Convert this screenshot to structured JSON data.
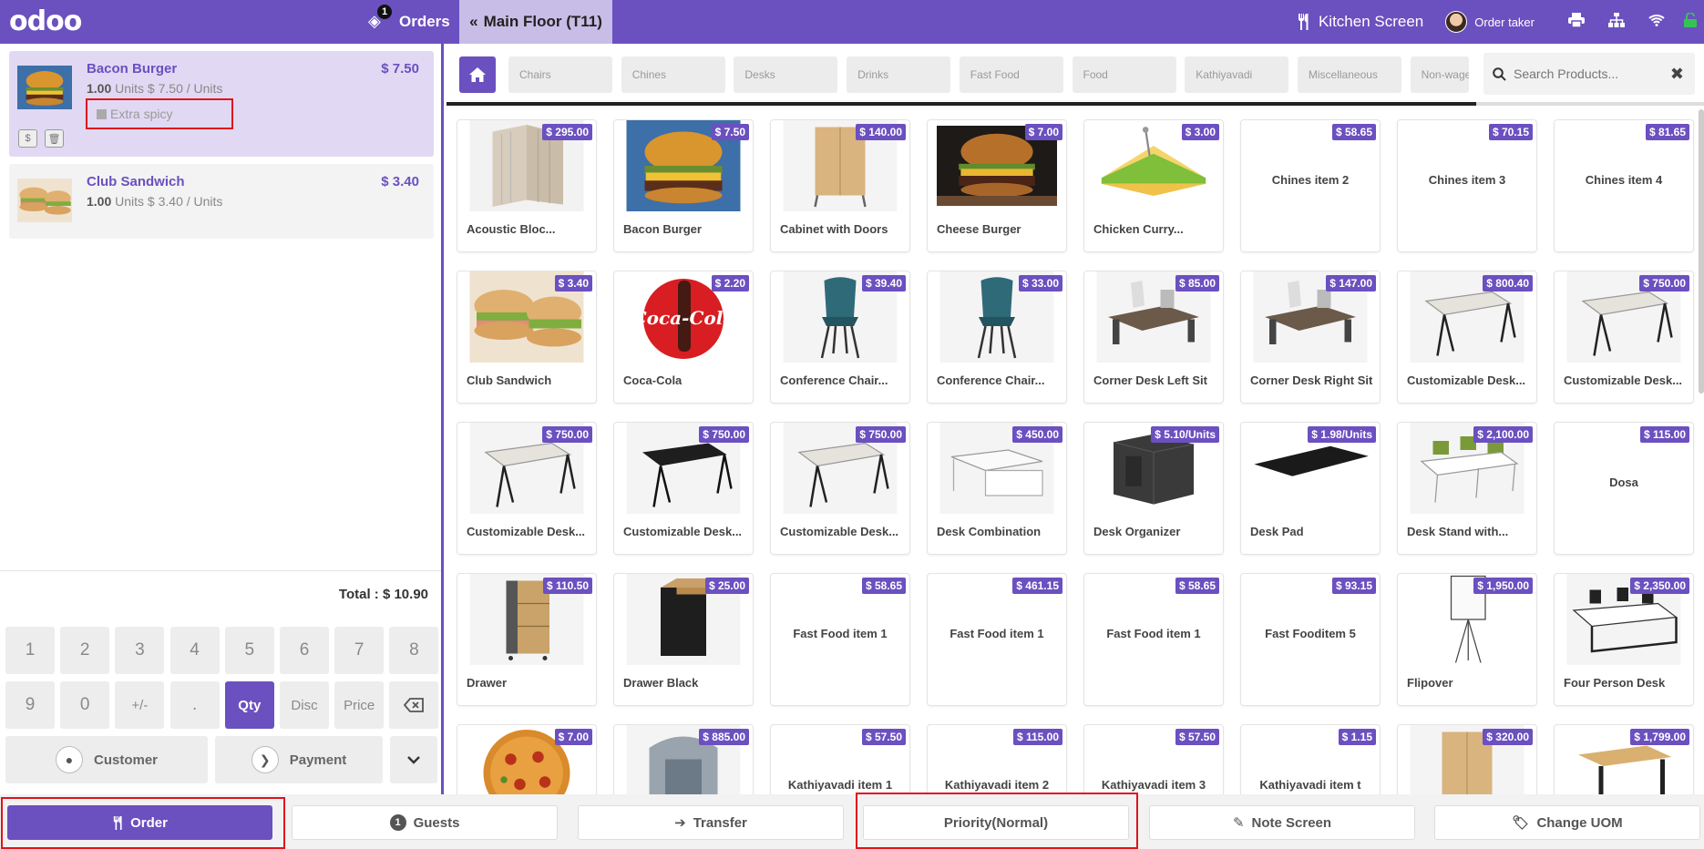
{
  "navbar": {
    "logo": "odoo",
    "orders_count": "1",
    "orders_label": "Orders",
    "floor_label": "Main Floor (T11)",
    "kitchen_label": "Kitchen Screen",
    "user_label": "Order taker"
  },
  "order_lines": [
    {
      "name": "Bacon Burger",
      "price": "$ 7.50",
      "qty": "1.00",
      "detail": "Units $ 7.50 / Units",
      "note": "Extra spicy",
      "img": "burger"
    },
    {
      "name": "Club Sandwich",
      "price": "$ 3.40",
      "qty": "1.00",
      "detail": "Units $ 3.40 / Units",
      "img": "sandwich"
    }
  ],
  "total": "Total : $ 10.90",
  "numpad": {
    "row1": [
      "1",
      "2",
      "3",
      "4",
      "5",
      "6",
      "7",
      "8"
    ],
    "row2": [
      "9",
      "0",
      "+/-",
      ".",
      "Qty",
      "Disc",
      "Price"
    ],
    "customer": "Customer",
    "payment": "Payment"
  },
  "categories": [
    "Chairs",
    "Chines",
    "Desks",
    "Drinks",
    "Fast Food",
    "Food",
    "Kathiyavadi",
    "Miscellaneous",
    "Non-wage"
  ],
  "search_placeholder": "Search Products...",
  "products": [
    {
      "name": "Acoustic Bloc...",
      "price": "$ 295.00",
      "img": "acoustic"
    },
    {
      "name": "Bacon Burger",
      "price": "$ 7.50",
      "img": "burger"
    },
    {
      "name": "Cabinet with Doors",
      "price": "$ 140.00",
      "img": "cabinet"
    },
    {
      "name": "Cheese Burger",
      "price": "$ 7.00",
      "img": "cheeseburger"
    },
    {
      "name": "Chicken Curry...",
      "price": "$ 3.00",
      "img": "chickensand"
    },
    {
      "name": "Chines item 2",
      "price": "$ 58.65",
      "img": ""
    },
    {
      "name": "Chines item 3",
      "price": "$ 70.15",
      "img": ""
    },
    {
      "name": "Chines item 4",
      "price": "$ 81.65",
      "img": ""
    },
    {
      "name": "Club Sandwich",
      "price": "$ 3.40",
      "img": "sandwich"
    },
    {
      "name": "Coca-Cola",
      "price": "$ 2.20",
      "img": "coke"
    },
    {
      "name": "Conference Chair...",
      "price": "$ 39.40",
      "img": "chair"
    },
    {
      "name": "Conference Chair...",
      "price": "$ 33.00",
      "img": "chair"
    },
    {
      "name": "Corner Desk Left Sit",
      "price": "$ 85.00",
      "img": "cornerdesk"
    },
    {
      "name": "Corner Desk Right Sit",
      "price": "$ 147.00",
      "img": "cornerdesk"
    },
    {
      "name": "Customizable Desk...",
      "price": "$ 800.40",
      "img": "desk"
    },
    {
      "name": "Customizable Desk...",
      "price": "$ 750.00",
      "img": "desk"
    },
    {
      "name": "Customizable Desk...",
      "price": "$ 750.00",
      "img": "desk"
    },
    {
      "name": "Customizable Desk...",
      "price": "$ 750.00",
      "img": "deskblack"
    },
    {
      "name": "Customizable Desk...",
      "price": "$ 750.00",
      "img": "desk"
    },
    {
      "name": "Desk Combination",
      "price": "$ 450.00",
      "img": "deskcombo"
    },
    {
      "name": "Desk Organizer",
      "price": "$ 5.10/Units",
      "img": "organizer"
    },
    {
      "name": "Desk Pad",
      "price": "$ 1.98/Units",
      "img": "deskpad"
    },
    {
      "name": "Desk Stand with...",
      "price": "$ 2,100.00",
      "img": "deskstand"
    },
    {
      "name": "Dosa",
      "price": "$ 115.00",
      "img": ""
    },
    {
      "name": "Drawer",
      "price": "$ 110.50",
      "img": "drawer"
    },
    {
      "name": "Drawer Black",
      "price": "$ 25.00",
      "img": "drawerblack"
    },
    {
      "name": "Fast Food item 1",
      "price": "$ 58.65",
      "img": ""
    },
    {
      "name": "Fast Food item 1",
      "price": "$ 461.15",
      "img": ""
    },
    {
      "name": "Fast Food item 1",
      "price": "$ 58.65",
      "img": ""
    },
    {
      "name": "Fast Fooditem 5",
      "price": "$ 93.15",
      "img": ""
    },
    {
      "name": "Flipover",
      "price": "$ 1,950.00",
      "img": "flipover"
    },
    {
      "name": "Four Person Desk",
      "price": "$ 2,350.00",
      "img": "fourdesk"
    },
    {
      "name": "",
      "price": "$ 7.00",
      "img": "pizza"
    },
    {
      "name": "",
      "price": "$ 885.00",
      "img": "booth"
    },
    {
      "name": "Kathiyavadi item 1",
      "price": "$ 57.50",
      "img": ""
    },
    {
      "name": "Kathiyavadi item 2",
      "price": "$ 115.00",
      "img": ""
    },
    {
      "name": "Kathiyavadi item 3",
      "price": "$ 57.50",
      "img": ""
    },
    {
      "name": "Kathiyavadi item t",
      "price": "$ 1.15",
      "img": ""
    },
    {
      "name": "",
      "price": "$ 320.00",
      "img": "cabinet"
    },
    {
      "name": "",
      "price": "$ 1,799.00",
      "img": "standdesk"
    }
  ],
  "actions": {
    "order": "Order",
    "guests_count": "1",
    "guests": "Guests",
    "transfer": "Transfer",
    "priority": "Priority(Normal)",
    "note_screen": "Note Screen",
    "change_uom": "Change UOM"
  }
}
